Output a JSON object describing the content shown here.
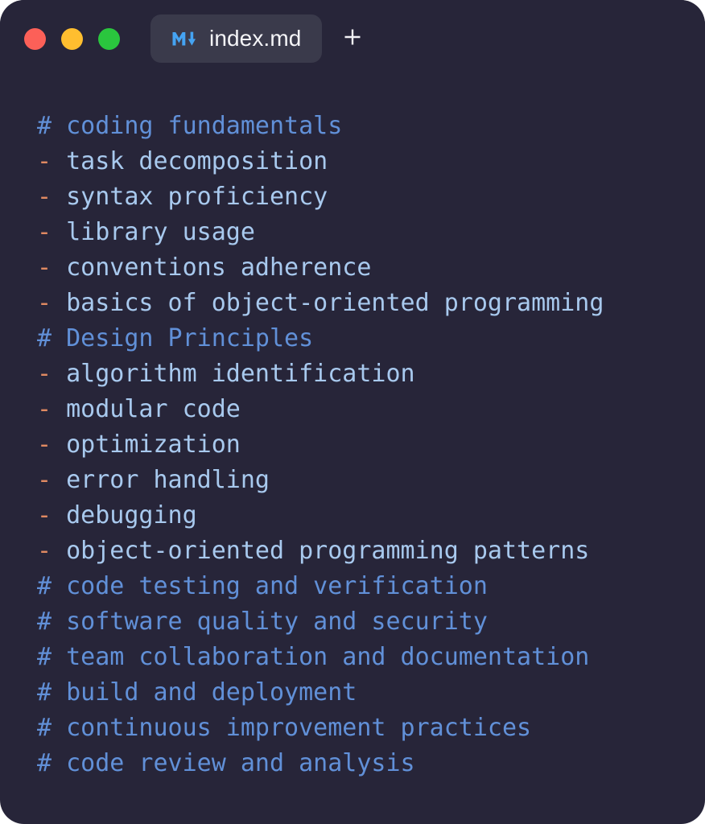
{
  "window": {
    "background_color": "#272539",
    "corner_radius_px": 30
  },
  "title_bar": {
    "traffic_lights": [
      {
        "name": "close",
        "color": "#fc6058"
      },
      {
        "name": "minimize",
        "color": "#ffbe2f"
      },
      {
        "name": "maximize",
        "color": "#2ac63e"
      }
    ],
    "tabs": [
      {
        "label": "index.md",
        "icon": "markdown-icon",
        "icon_color": "#45a3f2",
        "active": true,
        "background_color": "#3a3a4b"
      }
    ],
    "new_tab_label": "+"
  },
  "editor": {
    "language": "markdown",
    "colors": {
      "heading_marker": "#6190d8",
      "heading_text": "#6190d8",
      "list_marker": "#e08a62",
      "list_text": "#a8c9ee",
      "background": "#272539"
    },
    "lines": [
      {
        "type": "heading",
        "marker": "#",
        "text": "coding fundamentals"
      },
      {
        "type": "list",
        "marker": "-",
        "text": "task decomposition"
      },
      {
        "type": "list",
        "marker": "-",
        "text": "syntax proficiency"
      },
      {
        "type": "list",
        "marker": "-",
        "text": "library usage"
      },
      {
        "type": "list",
        "marker": "-",
        "text": "conventions adherence"
      },
      {
        "type": "list",
        "marker": "-",
        "text": "basics of object-oriented programming"
      },
      {
        "type": "heading",
        "marker": "#",
        "text": "Design Principles"
      },
      {
        "type": "list",
        "marker": "-",
        "text": "algorithm identification"
      },
      {
        "type": "list",
        "marker": "-",
        "text": "modular code"
      },
      {
        "type": "list",
        "marker": "-",
        "text": "optimization"
      },
      {
        "type": "list",
        "marker": "-",
        "text": "error handling"
      },
      {
        "type": "list",
        "marker": "-",
        "text": "debugging"
      },
      {
        "type": "list",
        "marker": "-",
        "text": "object-oriented programming patterns"
      },
      {
        "type": "heading",
        "marker": "#",
        "text": "code testing and verification"
      },
      {
        "type": "heading",
        "marker": "#",
        "text": "software quality and security"
      },
      {
        "type": "heading",
        "marker": "#",
        "text": "team collaboration and documentation"
      },
      {
        "type": "heading",
        "marker": "#",
        "text": "build and deployment"
      },
      {
        "type": "heading",
        "marker": "#",
        "text": "continuous improvement practices"
      },
      {
        "type": "heading",
        "marker": "#",
        "text": "code review and analysis"
      }
    ]
  }
}
